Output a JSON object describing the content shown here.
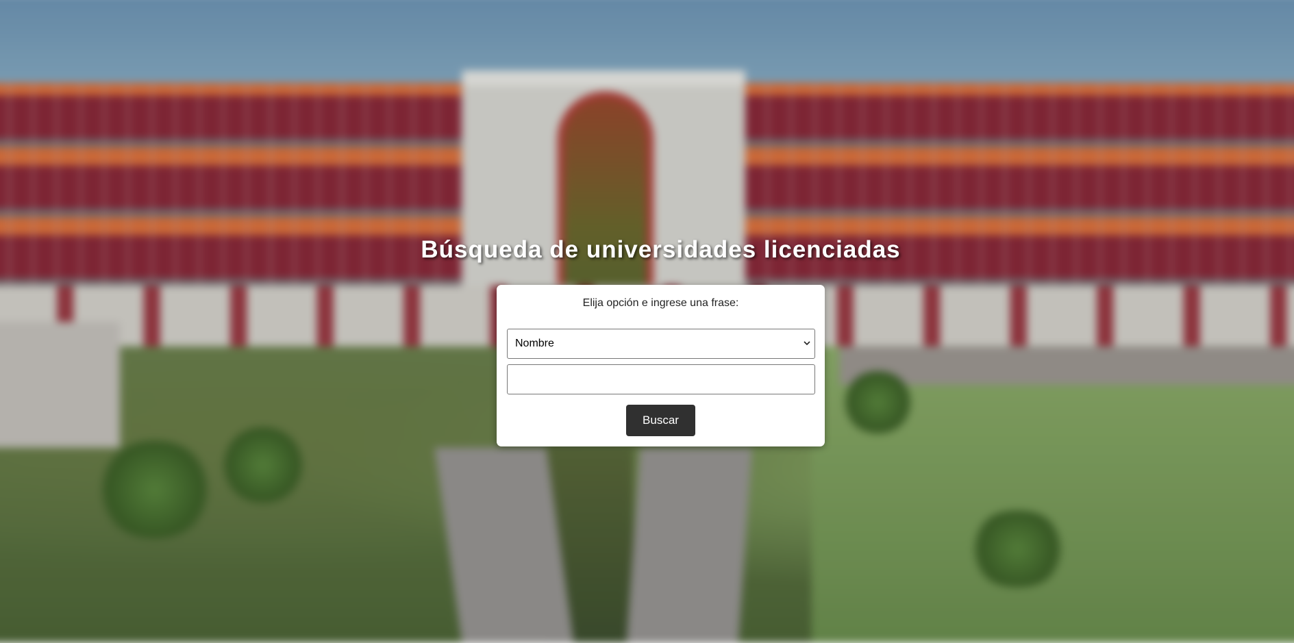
{
  "page": {
    "title": "Búsqueda de universidades licenciadas"
  },
  "form": {
    "prompt": "Elija opción e ingrese una frase:",
    "select": {
      "selected": "Nombre"
    },
    "input": {
      "value": "",
      "placeholder": ""
    },
    "submit_label": "Buscar"
  },
  "colors": {
    "button_bg": "#303030",
    "card_bg": "#ffffff",
    "title_text": "#ffffff"
  },
  "icons": {
    "select_arrow": "chevron-down-icon"
  }
}
